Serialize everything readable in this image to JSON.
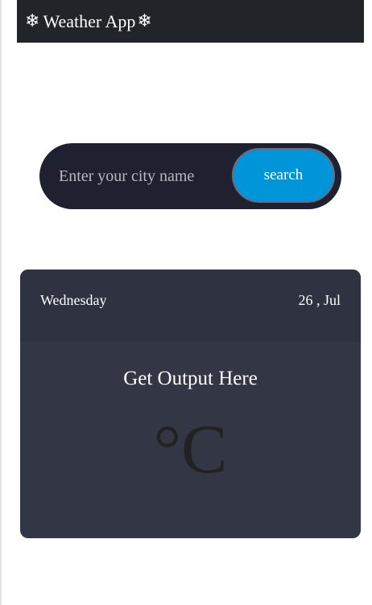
{
  "navbar": {
    "title": "Weather App",
    "left_icon": "snowflake-icon",
    "right_icon": "snowflake-icon",
    "snowflake_glyph": "❄",
    "background": "#212529"
  },
  "search": {
    "placeholder": "Enter your city name",
    "value": "",
    "button_label": "search",
    "button_color": "#0095d9",
    "bar_color": "#1f2030"
  },
  "card": {
    "day": "Wednesday",
    "date": "26 , Jul",
    "output_text": "Get Output Here",
    "temperature": "°C",
    "background": "#333644"
  }
}
